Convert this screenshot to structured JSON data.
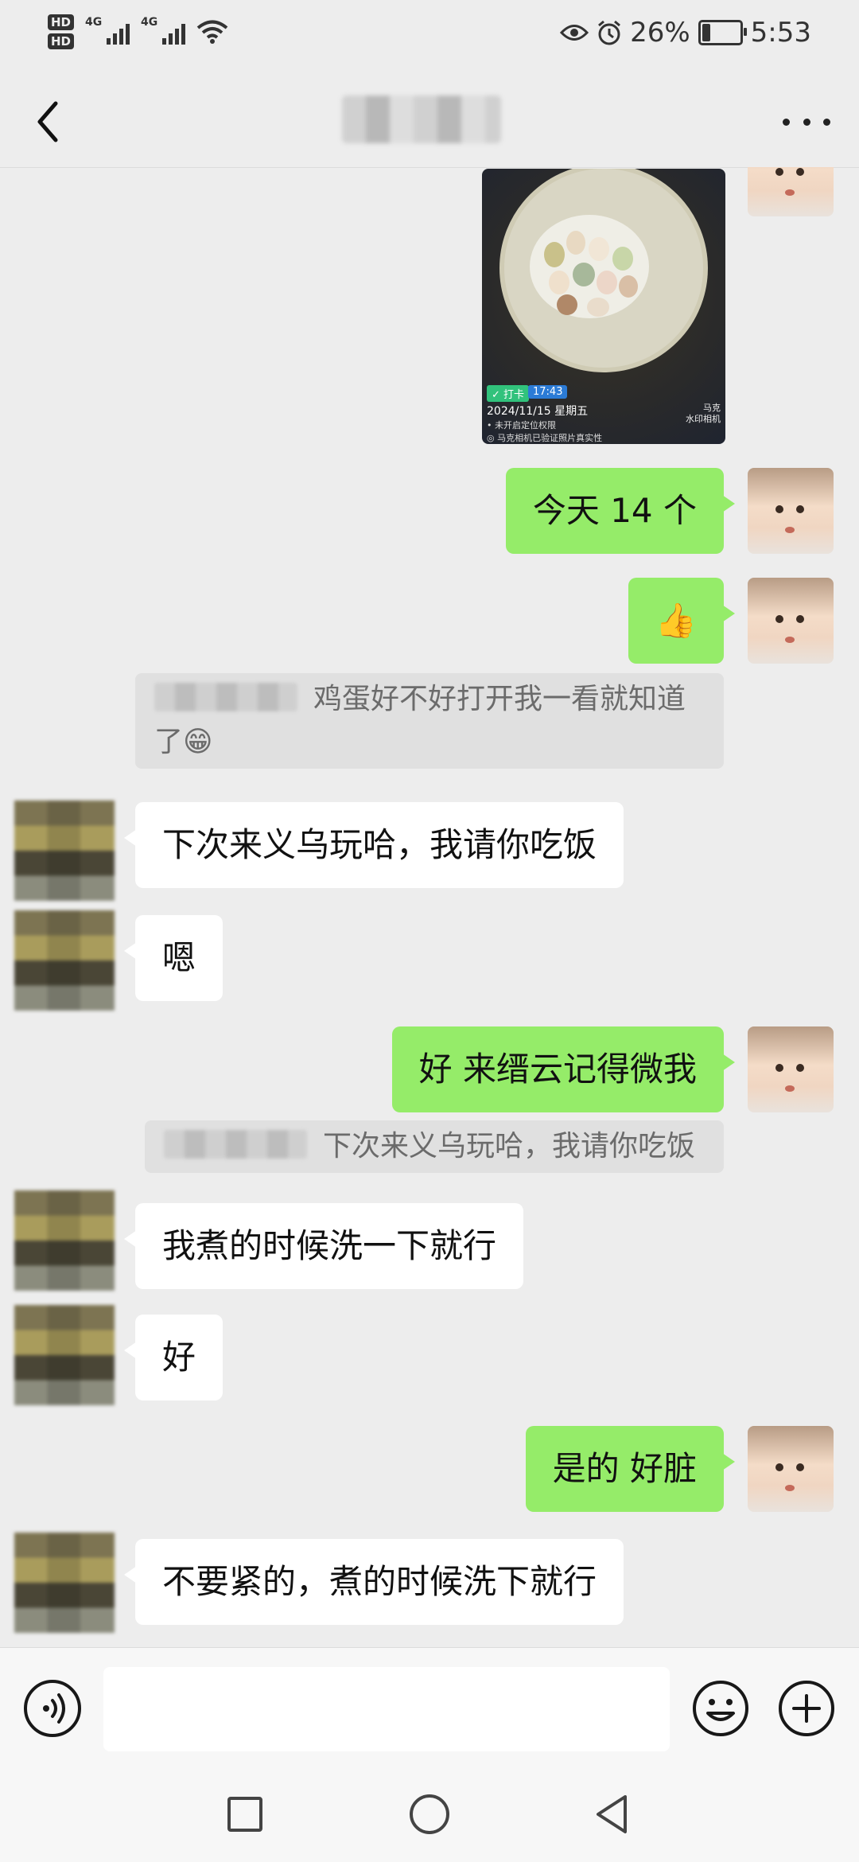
{
  "status_bar": {
    "hd1": "HD",
    "hd2": "HD",
    "net1": "4G",
    "net2": "4G",
    "battery": "26%",
    "battery_level": 0.26,
    "time": "5:53"
  },
  "header": {
    "title": "████"
  },
  "photo": {
    "tag": "✓ 打卡",
    "tag_time": "17:43",
    "date": "2024/11/15 星期五",
    "location": "• 未开启定位权限",
    "verify": "◎ 马克相机已验证照片真实性",
    "brand_line1": "马克",
    "brand_line2": "水印相机"
  },
  "messages": {
    "m1": "今天 14 个",
    "m2": "👍",
    "q1_name": "████",
    "q1_text": "鸡蛋好不好打开我一看就知道了😁",
    "m3": "下次来义乌玩哈，我请你吃饭",
    "m4": "嗯",
    "m5": "好 来缙云记得微我",
    "q2_name": "████",
    "q2_text": "下次来义乌玩哈，我请你吃饭",
    "m6": "我煮的时候洗一下就行",
    "m7": "好",
    "m8": "是的 好脏",
    "m9": "不要紧的，煮的时候洗下就行"
  },
  "input": {
    "value": ""
  },
  "icons": {
    "back": "back-arrow-icon",
    "more": "more-dots-icon",
    "voice": "voice-icon",
    "emoji": "emoji-icon",
    "plus": "plus-icon",
    "nav_recent": "square-icon",
    "nav_home": "circle-icon",
    "nav_back": "triangle-back-icon"
  },
  "colors": {
    "bubble_me": "#95ec69",
    "bubble_them": "#ffffff",
    "background": "#ededed"
  }
}
